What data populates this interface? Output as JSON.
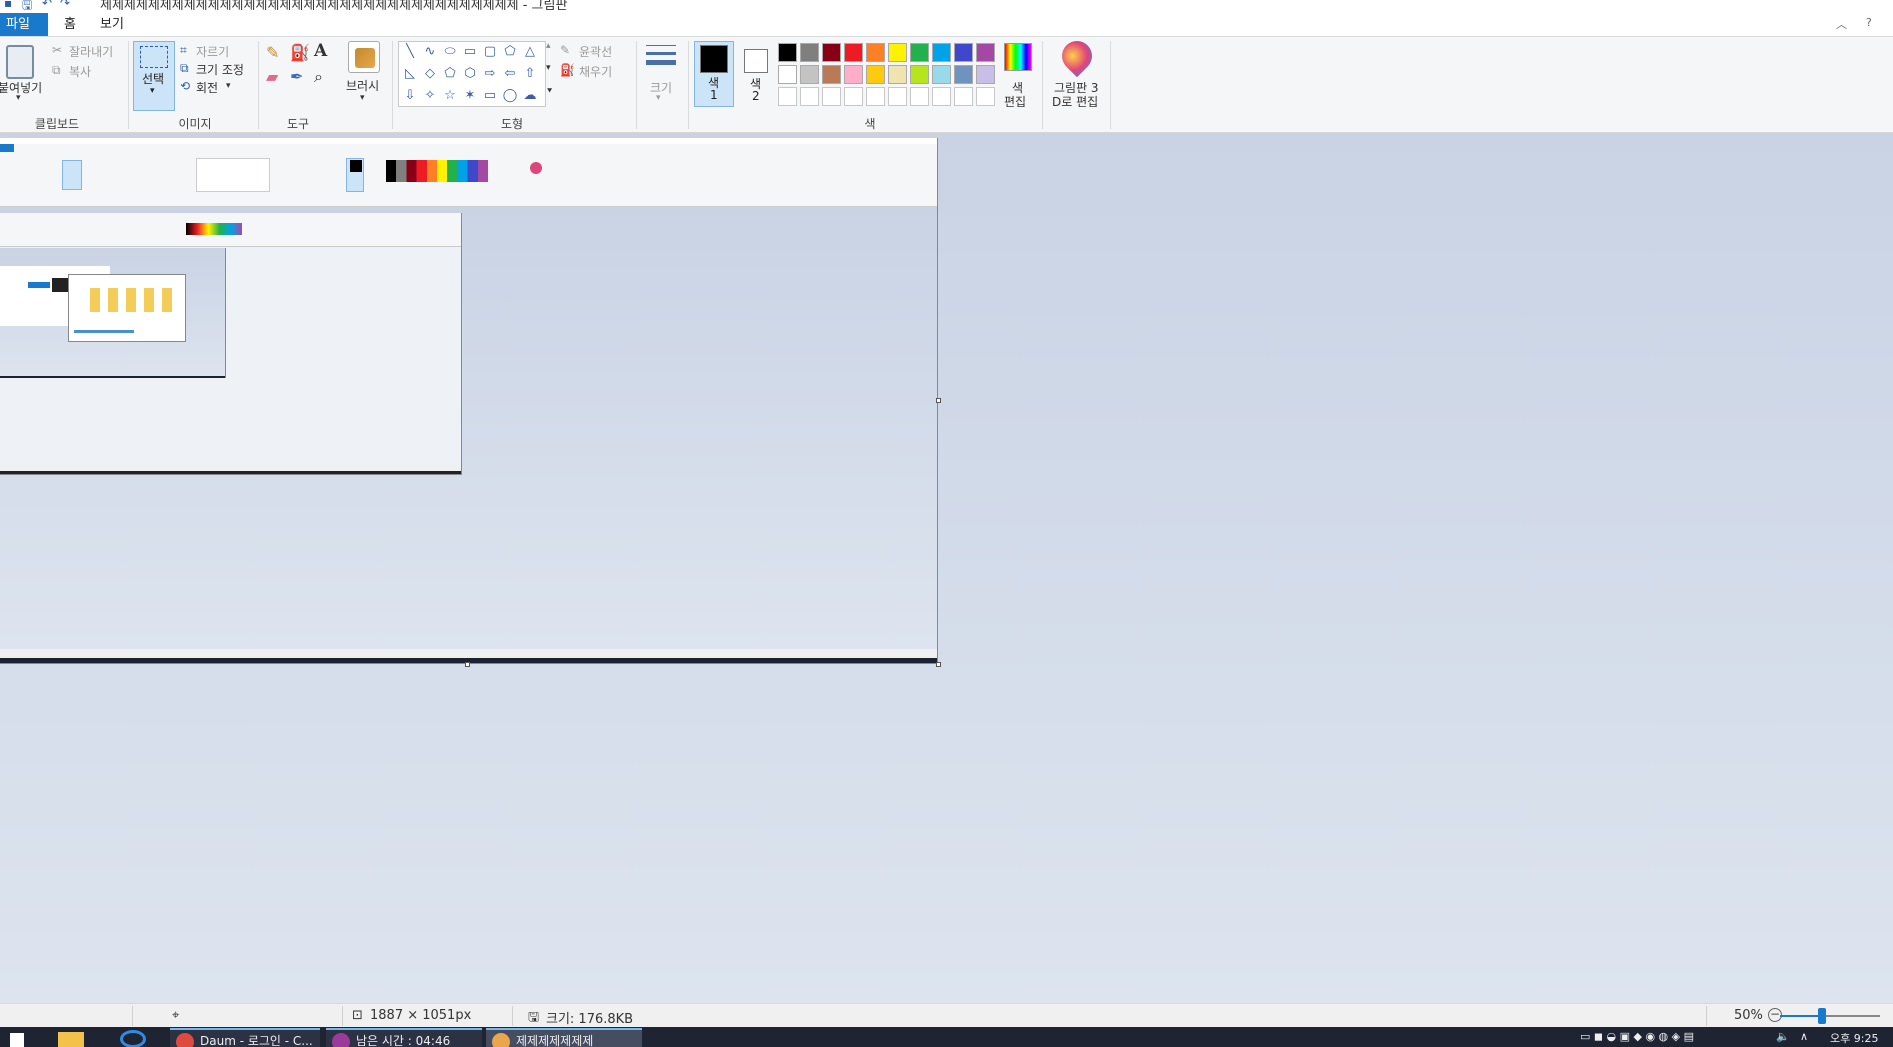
{
  "window": {
    "title": "제제제제제제제제제제제제제제제제제제제제제제제제제제제제제제제제제제제 - 그림판"
  },
  "tabs": {
    "file": "파일",
    "home": "홈",
    "view": "보기"
  },
  "clipboard": {
    "paste": "붙여넣기",
    "cut": "잘라내기",
    "copy": "복사",
    "label": "클립보드"
  },
  "image": {
    "select": "선택",
    "crop": "자르기",
    "resize": "크기 조정",
    "rotate": "회전",
    "label": "이미지"
  },
  "tools": {
    "label": "도구",
    "brush": "브러시"
  },
  "shapes": {
    "label": "도형",
    "outline": "윤곽선",
    "fill": "채우기",
    "items": [
      "╲",
      "∿",
      "⬭",
      "▭",
      "▢",
      "⬠",
      "△",
      "◺",
      "◇",
      "⬠",
      "⬡",
      "⇨",
      "⇦",
      "⇧",
      "⇩",
      "✧",
      "☆",
      "✶",
      "▭",
      "◯",
      "☁"
    ]
  },
  "size": {
    "label": "크기"
  },
  "colors": {
    "color1": "색\n1",
    "color1_a": "색",
    "color1_b": "1",
    "color2_a": "색",
    "color2_b": "2",
    "edit_a": "색",
    "edit_b": "편집",
    "label": "색",
    "palette_row1": [
      "#000000",
      "#7f7f7f",
      "#880015",
      "#ed1c24",
      "#ff7f27",
      "#fff200",
      "#22b14c",
      "#00a2e8",
      "#3f48cc",
      "#a349a4"
    ],
    "palette_row2": [
      "#ffffff",
      "#c3c3c3",
      "#b97a57",
      "#ffaec9",
      "#ffc90e",
      "#efe4b0",
      "#b5e61d",
      "#99d9ea",
      "#7092be",
      "#c8bfe7"
    ]
  },
  "paint3d": {
    "line1": "그림판 3",
    "line2": "D로 편집"
  },
  "status": {
    "dimensions": "1887 × 1051px",
    "size": "크기: 176.8KB",
    "zoom": "50%",
    "zoom_value": 0.5
  },
  "taskbar": {
    "items": [
      {
        "label": "Daum - 로그인 - C..."
      },
      {
        "label": "남은 시간 : 04:46"
      },
      {
        "label": "제제제제제제제"
      }
    ],
    "clock": "오후 9:25"
  }
}
